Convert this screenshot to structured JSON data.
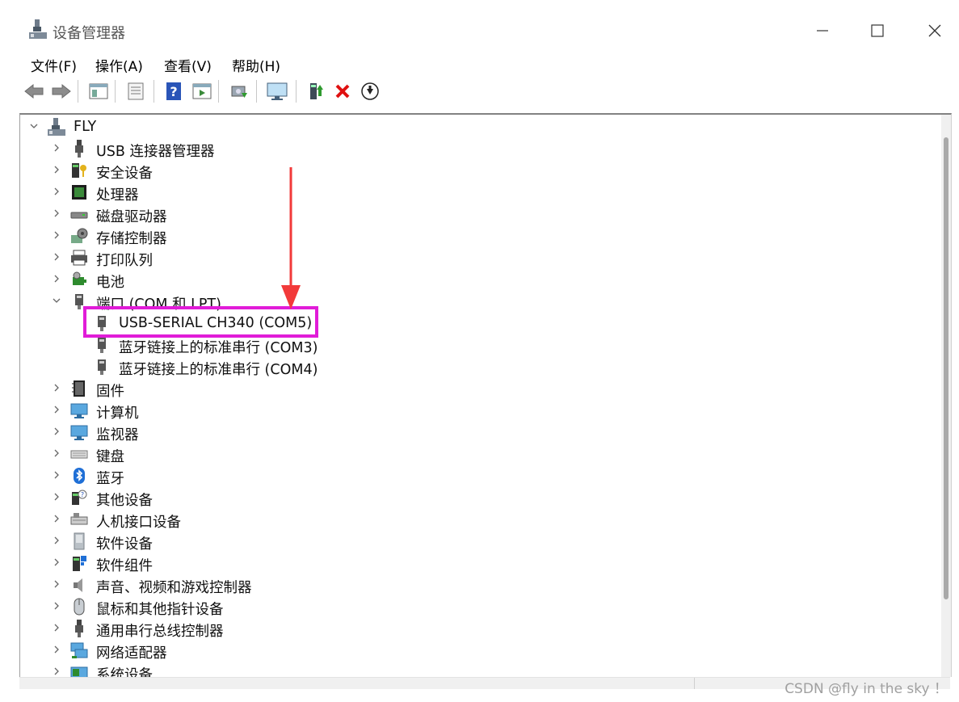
{
  "window": {
    "title": "设备管理器",
    "minimize_glyph": "—",
    "maximize_glyph": "☐",
    "close_glyph": "✕"
  },
  "menu": [
    "文件(F)",
    "操作(A)",
    "查看(V)",
    "帮助(H)"
  ],
  "toolbar": [
    "back-icon",
    "forward-icon",
    "show-hide-console-tree-icon",
    "properties-icon",
    "help-icon",
    "action-pane-icon",
    "scan-hardware-changes-icon",
    "monitor-icon",
    "update-driver-icon",
    "uninstall-icon",
    "disable-icon"
  ],
  "tree": {
    "root": "FLY",
    "rows": [
      {
        "label": "USB 连接器管理器",
        "icon": "usb-connector-icon",
        "state": "collapsed",
        "level": 1
      },
      {
        "label": "安全设备",
        "icon": "security-device-icon",
        "state": "collapsed",
        "level": 1
      },
      {
        "label": "处理器",
        "icon": "processor-icon",
        "state": "collapsed",
        "level": 1
      },
      {
        "label": "磁盘驱动器",
        "icon": "disk-drive-icon",
        "state": "collapsed",
        "level": 1
      },
      {
        "label": "存储控制器",
        "icon": "storage-controller-icon",
        "state": "collapsed",
        "level": 1
      },
      {
        "label": "打印队列",
        "icon": "printer-icon",
        "state": "collapsed",
        "level": 1
      },
      {
        "label": "电池",
        "icon": "battery-icon",
        "state": "collapsed",
        "level": 1
      },
      {
        "label": "端口 (COM 和 LPT)",
        "icon": "port-icon",
        "state": "expanded",
        "level": 1
      },
      {
        "label": "USB-SERIAL CH340 (COM5)",
        "icon": "port-device-icon",
        "state": "none",
        "level": 2
      },
      {
        "label": "蓝牙链接上的标准串行 (COM3)",
        "icon": "port-device-icon",
        "state": "none",
        "level": 2
      },
      {
        "label": "蓝牙链接上的标准串行 (COM4)",
        "icon": "port-device-icon",
        "state": "none",
        "level": 2
      },
      {
        "label": "固件",
        "icon": "firmware-icon",
        "state": "collapsed",
        "level": 1
      },
      {
        "label": "计算机",
        "icon": "computer-icon",
        "state": "collapsed",
        "level": 1
      },
      {
        "label": "监视器",
        "icon": "monitor-icon",
        "state": "collapsed",
        "level": 1
      },
      {
        "label": "键盘",
        "icon": "keyboard-icon",
        "state": "collapsed",
        "level": 1
      },
      {
        "label": "蓝牙",
        "icon": "bluetooth-icon",
        "state": "collapsed",
        "level": 1
      },
      {
        "label": "其他设备",
        "icon": "other-device-icon",
        "state": "collapsed",
        "level": 1
      },
      {
        "label": "人机接口设备",
        "icon": "hid-icon",
        "state": "collapsed",
        "level": 1
      },
      {
        "label": "软件设备",
        "icon": "software-device-icon",
        "state": "collapsed",
        "level": 1
      },
      {
        "label": "软件组件",
        "icon": "software-component-icon",
        "state": "collapsed",
        "level": 1
      },
      {
        "label": "声音、视频和游戏控制器",
        "icon": "sound-icon",
        "state": "collapsed",
        "level": 1
      },
      {
        "label": "鼠标和其他指针设备",
        "icon": "mouse-icon",
        "state": "collapsed",
        "level": 1
      },
      {
        "label": "通用串行总线控制器",
        "icon": "usb-controller-icon",
        "state": "collapsed",
        "level": 1
      },
      {
        "label": "网络适配器",
        "icon": "network-adapter-icon",
        "state": "collapsed",
        "level": 1
      },
      {
        "label": "系统设备",
        "icon": "system-device-icon",
        "state": "collapsed",
        "level": 1
      }
    ]
  },
  "watermark": "CSDN @fly in the sky ！",
  "colors": {
    "highlight": "#e11cd8",
    "arrow": "#f23a3a",
    "accent_blue": "#2a6fd6"
  }
}
